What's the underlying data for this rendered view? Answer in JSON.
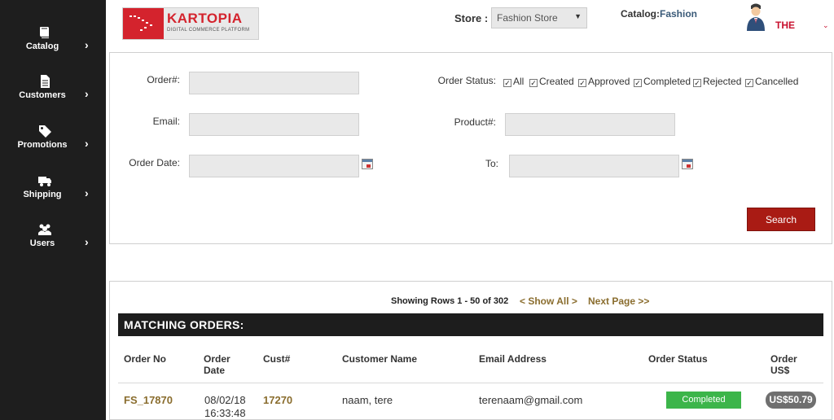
{
  "sidebar": {
    "items": [
      {
        "label": "Catalog",
        "icon": "book-icon"
      },
      {
        "label": "Customers",
        "icon": "document-icon"
      },
      {
        "label": "Promotions",
        "icon": "tag-icon"
      },
      {
        "label": "Shipping",
        "icon": "truck-icon"
      },
      {
        "label": "Users",
        "icon": "users-icon"
      }
    ]
  },
  "header": {
    "logo": {
      "brand": "KARTOPIA",
      "tagline": "DIGITAL COMMERCE PLATFORM"
    },
    "store_label": "Store :",
    "store_value": "Fashion Store",
    "catalog_label": "Catalog:",
    "catalog_value": "Fashion",
    "user_name": "THE"
  },
  "filters": {
    "order_no_label": "Order#:",
    "email_label": "Email:",
    "order_date_label": "Order Date:",
    "to_label": "To:",
    "product_label": "Product#:",
    "order_status_label": "Order Status:",
    "statuses": [
      "All",
      "Created",
      "Approved",
      "Completed",
      "Rejected",
      "Cancelled"
    ],
    "search_button": "Search"
  },
  "results": {
    "rows_info": "Showing Rows 1 - 50 of 302",
    "show_all": "< Show All >",
    "next_page": "Next Page >>",
    "section_title": "MATCHING ORDERS:",
    "columns": {
      "order_no": "Order No",
      "order_date_1": "Order",
      "order_date_2": "Date",
      "cust": "Cust#",
      "customer_name": "Customer Name",
      "email": "Email Address",
      "status": "Order Status",
      "amount_1": "Order",
      "amount_2": "US$"
    },
    "rows": [
      {
        "order_no": "FS_17870",
        "date_1": "08/02/18",
        "date_2": "16:33:48",
        "cust": "17270",
        "name": "naam, tere",
        "email": "terenaam@gmail.com",
        "status": "Completed",
        "amount": "US$50.79"
      }
    ]
  },
  "colors": {
    "sidebar_bg": "#1e1e1e",
    "brand_red": "#d4232d",
    "search_button": "#a91b14",
    "link_gold": "#8a6d2e",
    "status_completed": "#3cb54a"
  }
}
